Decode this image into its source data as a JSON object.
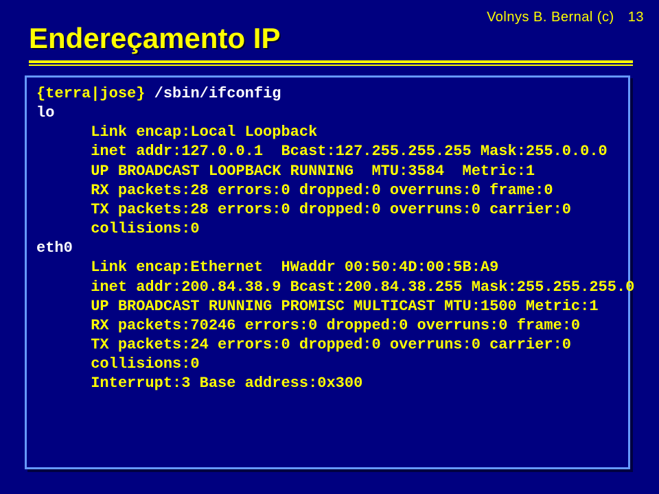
{
  "header": {
    "copyright": "Volnys B. Bernal (c)",
    "pagenum": "13"
  },
  "title": "Endereçamento IP",
  "terminal": {
    "prompt_host": "{terra|jose}",
    "command": " /sbin/ifconfig",
    "lo": {
      "name": "lo",
      "l1": "      Link encap:Local Loopback",
      "l2": "      inet addr:127.0.0.1  Bcast:127.255.255.255 Mask:255.0.0.0",
      "l3": "      UP BROADCAST LOOPBACK RUNNING  MTU:3584  Metric:1",
      "l4": "      RX packets:28 errors:0 dropped:0 overruns:0 frame:0",
      "l5": "      TX packets:28 errors:0 dropped:0 overruns:0 carrier:0",
      "l6": "      collisions:0"
    },
    "eth0": {
      "name": "eth0",
      "l1": "      Link encap:Ethernet  HWaddr 00:50:4D:00:5B:A9",
      "l2": "      inet addr:200.84.38.9 Bcast:200.84.38.255 Mask:255.255.255.0",
      "l3": "      UP BROADCAST RUNNING PROMISC MULTICAST MTU:1500 Metric:1",
      "l4": "      RX packets:70246 errors:0 dropped:0 overruns:0 frame:0",
      "l5": "      TX packets:24 errors:0 dropped:0 overruns:0 carrier:0",
      "l6": "      collisions:0",
      "l7": "      Interrupt:3 Base address:0x300"
    }
  }
}
